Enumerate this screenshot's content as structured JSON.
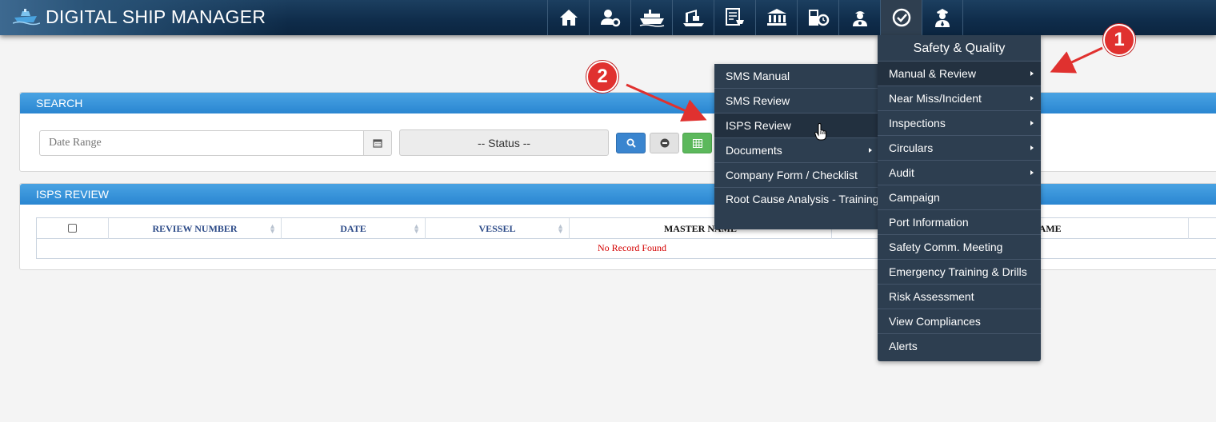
{
  "app": {
    "title": "DIGITAL SHIP MANAGER"
  },
  "nav": {
    "icons": [
      "home-icon",
      "user-settings-icon",
      "ship-icon",
      "crane-icon",
      "purchase-icon",
      "bank-icon",
      "fuel-icon",
      "crew-icon",
      "safety-check-icon",
      "officer-icon"
    ],
    "active_index": 8
  },
  "search": {
    "title": "SEARCH",
    "date_placeholder": "Date Range",
    "status_label": "-- Status --"
  },
  "review": {
    "title": "ISPS REVIEW",
    "columns": [
      "REVIEW NUMBER",
      "DATE",
      "VESSEL",
      "MASTER NAME",
      "NAME"
    ],
    "empty_message": "No Record Found"
  },
  "menu": {
    "title": "Safety & Quality",
    "items": [
      {
        "label": "Manual & Review",
        "submenu": true
      },
      {
        "label": "Near Miss/Incident",
        "submenu": true
      },
      {
        "label": "Inspections",
        "submenu": true
      },
      {
        "label": "Circulars",
        "submenu": true
      },
      {
        "label": "Audit",
        "submenu": true
      },
      {
        "label": "Campaign",
        "submenu": false
      },
      {
        "label": "Port Information",
        "submenu": false
      },
      {
        "label": "Safety Comm. Meeting",
        "submenu": false
      },
      {
        "label": "Emergency Training & Drills",
        "submenu": false
      },
      {
        "label": "Risk Assessment",
        "submenu": false
      },
      {
        "label": "View Compliances",
        "submenu": false
      },
      {
        "label": "Alerts",
        "submenu": false
      }
    ]
  },
  "submenu": {
    "items": [
      {
        "label": "SMS Manual",
        "submenu": false
      },
      {
        "label": "SMS Review",
        "submenu": false
      },
      {
        "label": "ISPS Review",
        "submenu": false
      },
      {
        "label": "Documents",
        "submenu": true
      },
      {
        "label": "Company Form / Checklist",
        "submenu": false
      },
      {
        "label": "Root Cause Analysis - Training",
        "submenu": false
      }
    ]
  },
  "annotations": {
    "marker_1": "1",
    "marker_2": "2"
  },
  "colors": {
    "header": "#0f2c4a",
    "panel_head": "#2a86d1",
    "menu_bg": "#2d3e50",
    "marker": "#e0312f",
    "empty_text": "#d40000"
  }
}
